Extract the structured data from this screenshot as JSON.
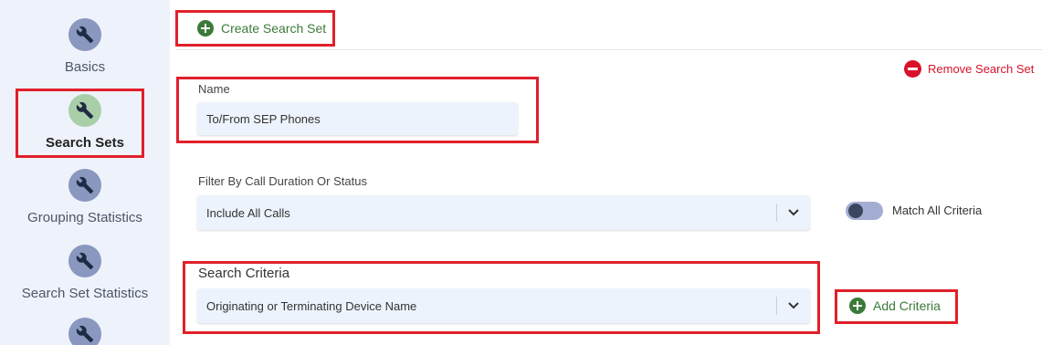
{
  "sidebar": {
    "items": [
      {
        "label": "Basics",
        "icon": "wrench-icon",
        "active": false
      },
      {
        "label": "Search Sets",
        "icon": "wrench-icon",
        "active": true
      },
      {
        "label": "Grouping Statistics",
        "icon": "wrench-icon",
        "active": false
      },
      {
        "label": "Search Set Statistics",
        "icon": "wrench-icon",
        "active": false
      },
      {
        "label": "",
        "icon": "wrench-icon",
        "active": false
      }
    ]
  },
  "toolbar": {
    "create_label": "Create Search Set",
    "remove_label": "Remove Search Set"
  },
  "form": {
    "name_label": "Name",
    "name_value": "To/From SEP Phones",
    "filter_label": "Filter By Call Duration Or Status",
    "filter_value": "Include All Calls",
    "match_all_label": "Match All Criteria",
    "match_all_on": false,
    "criteria_label": "Search Criteria",
    "criteria_value": "Originating or Terminating Device Name",
    "add_criteria_label": "Add Criteria"
  },
  "colors": {
    "accent_green": "#3c7a3a",
    "danger_red": "#d9122b",
    "highlight_box": "#e0202a",
    "nav_icon": "#8a97bf",
    "nav_icon_active": "#a9cfa8"
  }
}
